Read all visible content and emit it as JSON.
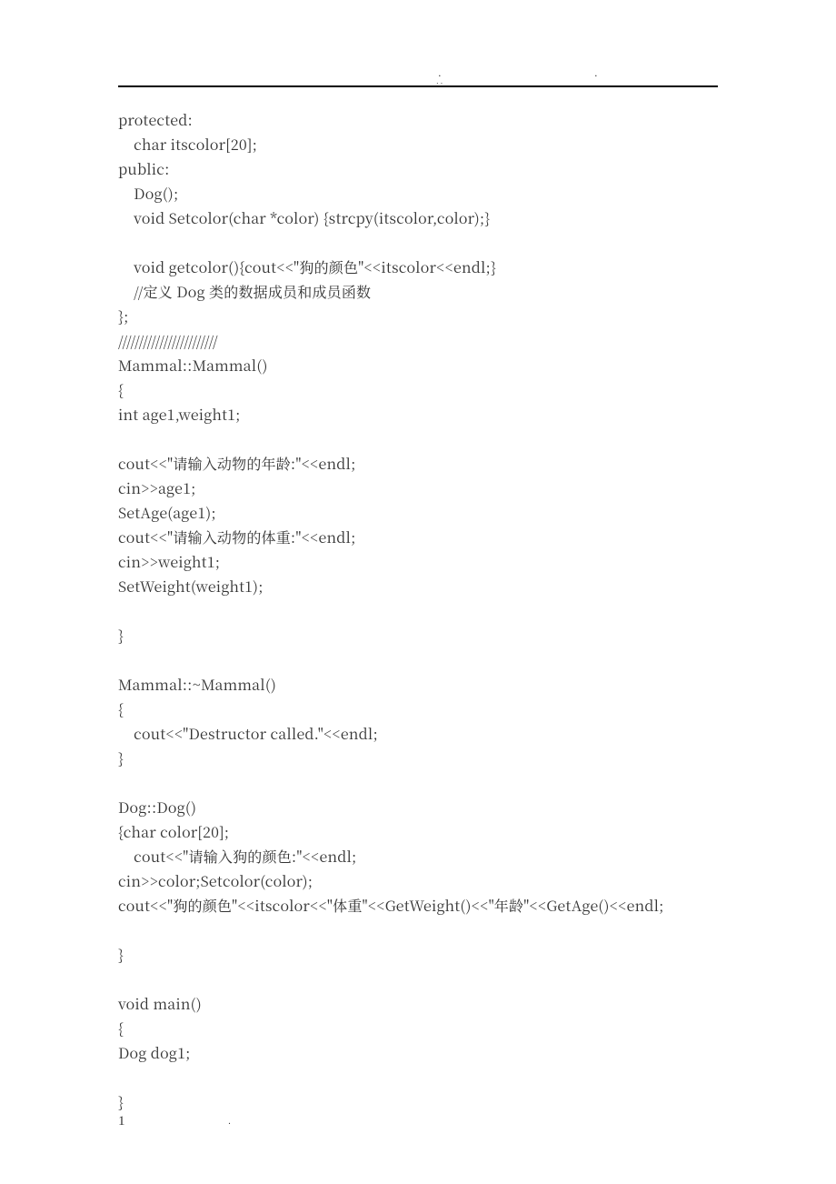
{
  "header": {
    "dot_a": ".",
    "dot_b": ".",
    "dots_mid": ". ."
  },
  "code": "protected:\n    char itscolor[20];\npublic:\n    Dog();\n    void Setcolor(char *color) {strcpy(itscolor,color);}\n\n    void getcolor(){cout<<\"狗的颜色\"<<itscolor<<endl;}\n    //定义 Dog 类的数据成员和成员函数\n};\n////////////////////////\nMammal::Mammal()\n{\nint age1,weight1;\n\ncout<<\"请输入动物的年龄:\"<<endl;\ncin>>age1;\nSetAge(age1);\ncout<<\"请输入动物的体重:\"<<endl;\ncin>>weight1;\nSetWeight(weight1);\n\n}\n\nMammal::~Mammal()\n{\n    cout<<\"Destructor called.\"<<endl;\n}\n\nDog::Dog()\n{char color[20];\n    cout<<\"请输入狗的颜色:\"<<endl;\ncin>>color;Setcolor(color);\ncout<<\"狗的颜色\"<<itscolor<<\"体重\"<<GetWeight()<<\"年龄\"<<GetAge()<<endl;\n\n}\n\nvoid main()\n{\nDog dog1;\n\n}",
  "footer": {
    "page_number": "1",
    "dot": "."
  }
}
